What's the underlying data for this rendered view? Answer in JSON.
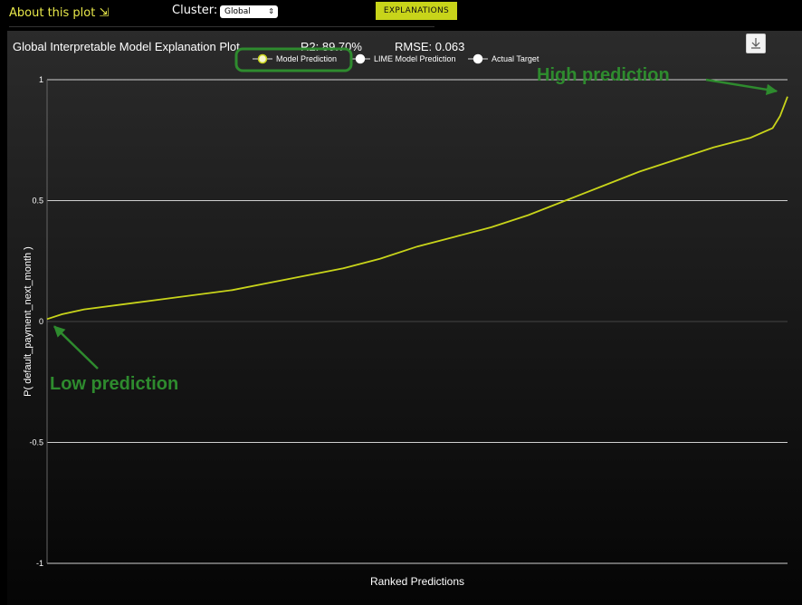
{
  "toolbar": {
    "about_label": "About this plot ⇲",
    "cluster_label": "Cluster:",
    "cluster_value": "Global",
    "explanations_label": "EXPLANATIONS"
  },
  "colors": {
    "model_line": "#c8d41a",
    "annotation": "#2e8b2e",
    "about_text": "#e8e84a"
  },
  "chart_data": {
    "type": "line",
    "title": "Global Interpretable Model Explanation Plot",
    "r2_label": "R2: 89.70%",
    "rmse_label": "RMSE: 0.063",
    "xlabel": "Ranked Predictions",
    "ylabel": "P( default_payment_next_month )",
    "ylim": [
      -1,
      1.2
    ],
    "yticks": [
      1,
      0.5,
      0,
      -0.5,
      -1
    ],
    "ytick_labels": [
      "1",
      "0.5",
      "0",
      "-0.5",
      "-1"
    ],
    "grid": true,
    "legend": [
      "Model Prediction",
      "LIME Model Prediction",
      "Actual Target"
    ],
    "legend_position": "top",
    "series": [
      {
        "name": "Model Prediction",
        "x": [
          0,
          0.02,
          0.05,
          0.1,
          0.15,
          0.2,
          0.25,
          0.3,
          0.35,
          0.4,
          0.45,
          0.5,
          0.55,
          0.6,
          0.65,
          0.7,
          0.75,
          0.8,
          0.85,
          0.9,
          0.95,
          0.98,
          0.99,
          1.0
        ],
        "values": [
          0.01,
          0.03,
          0.05,
          0.07,
          0.09,
          0.11,
          0.13,
          0.16,
          0.19,
          0.22,
          0.26,
          0.31,
          0.35,
          0.39,
          0.44,
          0.5,
          0.56,
          0.62,
          0.67,
          0.72,
          0.76,
          0.8,
          0.85,
          0.93
        ]
      }
    ],
    "annotations": [
      {
        "text": "High  prediction",
        "x": 1.0,
        "y": 0.93
      },
      {
        "text": "Low prediction",
        "x": 0.0,
        "y": 0.01
      }
    ]
  }
}
